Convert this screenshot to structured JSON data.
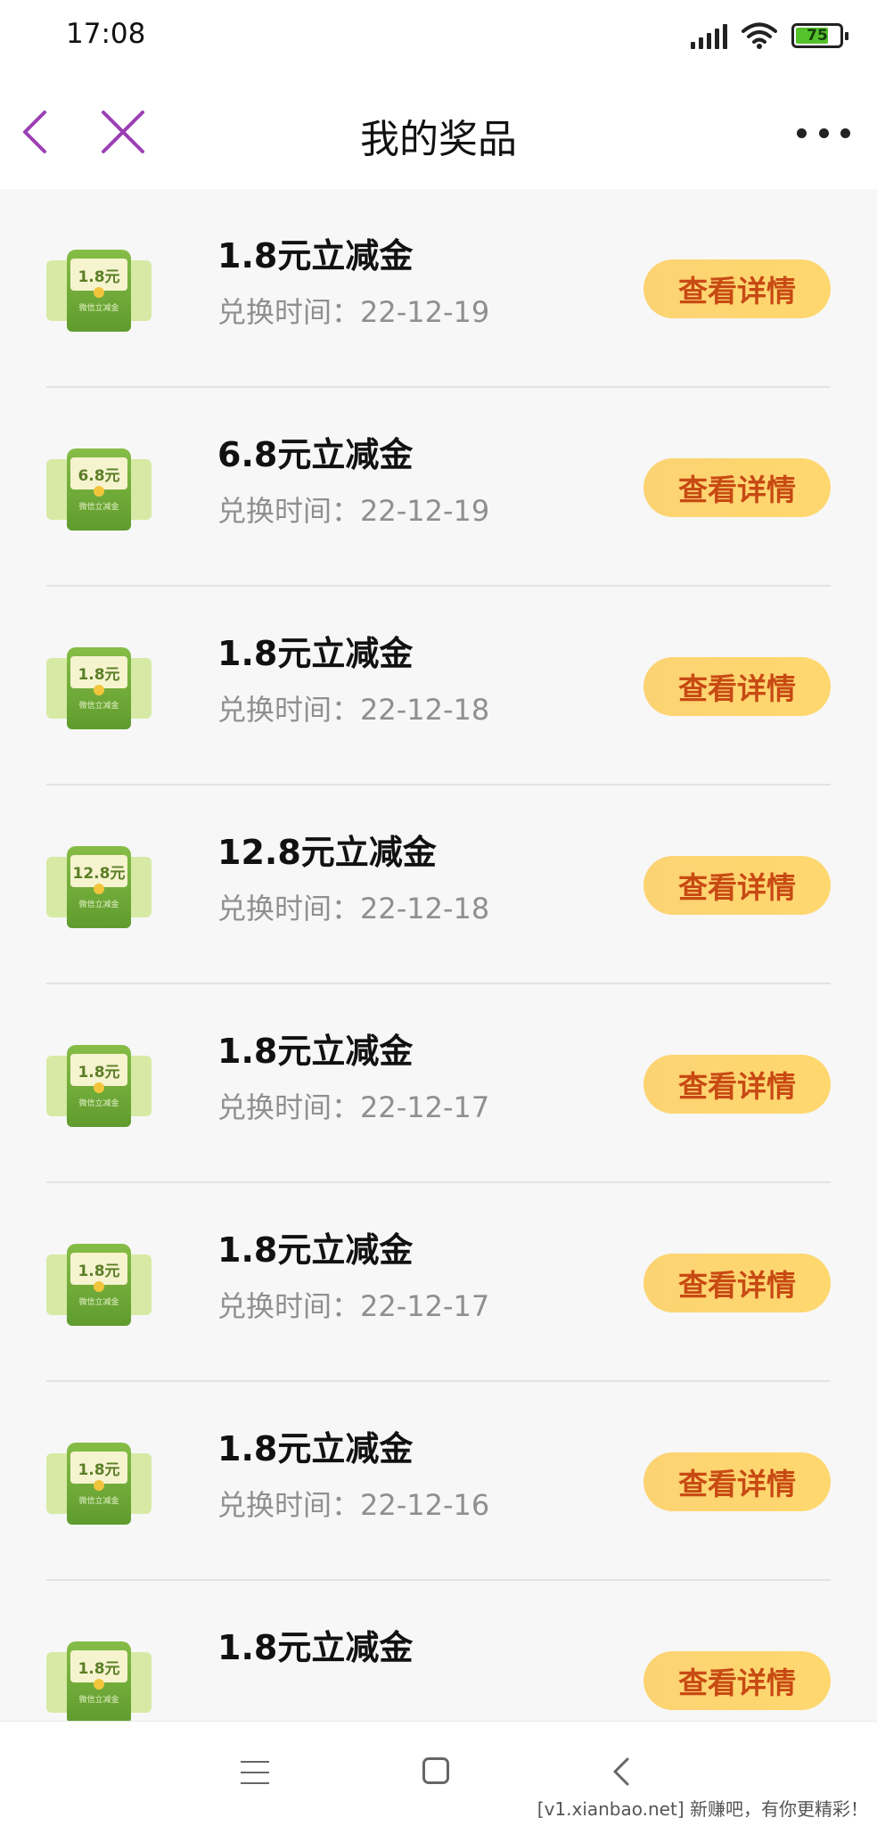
{
  "status_bar": {
    "time": "17:08",
    "battery": "75",
    "icons": [
      "signal-icon",
      "wifi-icon",
      "battery-icon"
    ]
  },
  "nav": {
    "title": "我的奖品",
    "icons": [
      "back-arrow-icon",
      "close-icon",
      "more-icon"
    ],
    "accent_color": "#9b3fb5"
  },
  "prizes": [
    {
      "thumb_amount": "1.8元",
      "thumb_label": "微信立减金",
      "title": "1.8元立减金",
      "date": "兑换时间：22-12-19",
      "button": "查看详情"
    },
    {
      "thumb_amount": "6.8元",
      "thumb_label": "微信立减金",
      "title": "6.8元立减金",
      "date": "兑换时间：22-12-19",
      "button": "查看详情"
    },
    {
      "thumb_amount": "1.8元",
      "thumb_label": "微信立减金",
      "title": "1.8元立减金",
      "date": "兑换时间：22-12-18",
      "button": "查看详情"
    },
    {
      "thumb_amount": "12.8元",
      "thumb_label": "微信立减金",
      "title": "12.8元立减金",
      "date": "兑换时间：22-12-18",
      "button": "查看详情"
    },
    {
      "thumb_amount": "1.8元",
      "thumb_label": "微信立减金",
      "title": "1.8元立减金",
      "date": "兑换时间：22-12-17",
      "button": "查看详情"
    },
    {
      "thumb_amount": "1.8元",
      "thumb_label": "微信立减金",
      "title": "1.8元立减金",
      "date": "兑换时间：22-12-17",
      "button": "查看详情"
    },
    {
      "thumb_amount": "1.8元",
      "thumb_label": "微信立减金",
      "title": "1.8元立减金",
      "date": "兑换时间：22-12-16",
      "button": "查看详情"
    },
    {
      "thumb_amount": "1.8元",
      "thumb_label": "微信立减金",
      "title": "1.8元立减金",
      "date": "",
      "button": "查看详情"
    }
  ],
  "colors": {
    "button_bg": "#fdd56f",
    "button_text": "#c84a13",
    "thumb_green": "#6fa83a"
  },
  "bottom_nav": {
    "icons": [
      "menu-icon",
      "home-icon",
      "back-icon"
    ]
  },
  "watermark": "[v1.xianbao.net] 新赚吧，有你更精彩！"
}
